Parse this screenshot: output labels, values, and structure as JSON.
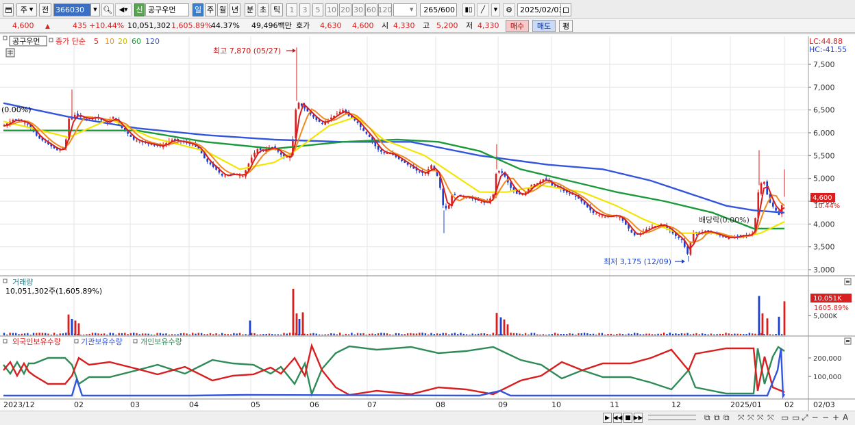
{
  "toolbar": {
    "mode": "주",
    "prev_label": "전",
    "code": "366030",
    "name_tag": "신",
    "name": "공구우먼",
    "periods": [
      "일",
      "주",
      "월",
      "년",
      "분",
      "초",
      "틱"
    ],
    "active_period": "일",
    "intervals": [
      "1",
      "3",
      "5",
      "10",
      "20",
      "30",
      "60",
      "120"
    ],
    "count": "265",
    "count_total": "/600",
    "date": "2025/02/03"
  },
  "quote": {
    "price": "4,600",
    "change": "435",
    "change_pct": "+10.44%",
    "volume": "10,051,302",
    "volume_pct": "1,605.89%",
    "turnover_pct": "44.37%",
    "amount": "49,496백만",
    "bid_label": "호가",
    "bid1": "4,630",
    "bid2": "4,600",
    "open_label": "시",
    "open": "4,330",
    "high_label": "고",
    "high": "5,200",
    "low_label": "저",
    "low": "4,330",
    "buy_label": "매수",
    "sell_label": "매도",
    "eval_label": "평"
  },
  "price_panel": {
    "stock_label": "공구우먼",
    "indicator_label": "종가 단순",
    "ma_labels": [
      "5",
      "10",
      "20",
      "60",
      "120"
    ],
    "ma_colors": [
      "#d81e1e",
      "#f08a1e",
      "#e8d800",
      "#1a9a3a",
      "#3355dd"
    ],
    "lc": "LC:44.88",
    "hc": "HC:-41.55",
    "high_annot": "최고 7,870 (05/27)",
    "low_annot": "최저 3,175 (12/09)",
    "start_pct": "(0.00%)",
    "dividend": "배당락(0.00%)",
    "last_price": "4,600",
    "last_pct": "10.44%",
    "y_ticks": [
      "7,500",
      "7,000",
      "6,500",
      "6,000",
      "5,500",
      "5,000",
      "4,500",
      "4,000",
      "3,500",
      "3,000"
    ]
  },
  "volume_panel": {
    "title": "거래량",
    "subtitle": "10,051,302주(1,605.89%)",
    "last_value": "10,051K",
    "last_pct": "1605.89%",
    "tick": "5,000K"
  },
  "holding_panel": {
    "legend": [
      "외국인보유수량",
      "기관보유수량",
      "개인보유수량"
    ],
    "colors": [
      "#d81e1e",
      "#3355dd",
      "#2e8b57"
    ],
    "ticks": [
      "200,000",
      "100,000"
    ]
  },
  "x_axis": {
    "labels": [
      "2023/12",
      "02",
      "03",
      "04",
      "05",
      "06",
      "07",
      "08",
      "09",
      "10",
      "11",
      "12",
      "2025/01",
      "02",
      "02/03"
    ]
  },
  "chart_data": {
    "type": "candlestick",
    "ylim": [
      2900,
      7900
    ],
    "annotations": [
      {
        "text": "최고 7,870 (05/27)",
        "value": 7870
      },
      {
        "text": "최저 3,175 (12/09)",
        "value": 3175
      }
    ],
    "close_path": [
      [
        0,
        6100
      ],
      [
        10,
        6200
      ],
      [
        20,
        6300
      ],
      [
        30,
        6250
      ],
      [
        40,
        6200
      ],
      [
        55,
        5900
      ],
      [
        70,
        5750
      ],
      [
        85,
        5600
      ],
      [
        95,
        5700
      ],
      [
        100,
        6300
      ],
      [
        110,
        6400
      ],
      [
        125,
        6300
      ],
      [
        140,
        6350
      ],
      [
        155,
        6200
      ],
      [
        165,
        6350
      ],
      [
        175,
        6150
      ],
      [
        185,
        6000
      ],
      [
        195,
        5850
      ],
      [
        205,
        5800
      ],
      [
        220,
        5750
      ],
      [
        235,
        5700
      ],
      [
        250,
        5850
      ],
      [
        265,
        5800
      ],
      [
        280,
        5750
      ],
      [
        290,
        5650
      ],
      [
        300,
        5400
      ],
      [
        315,
        5200
      ],
      [
        325,
        5050
      ],
      [
        340,
        5100
      ],
      [
        355,
        5050
      ],
      [
        365,
        5400
      ],
      [
        375,
        5650
      ],
      [
        385,
        5600
      ],
      [
        395,
        5700
      ],
      [
        405,
        5600
      ],
      [
        415,
        5450
      ],
      [
        425,
        5500
      ],
      [
        433,
        6700
      ],
      [
        440,
        6600
      ],
      [
        450,
        6450
      ],
      [
        460,
        6300
      ],
      [
        470,
        6200
      ],
      [
        480,
        6300
      ],
      [
        490,
        6400
      ],
      [
        500,
        6500
      ],
      [
        510,
        6350
      ],
      [
        520,
        6250
      ],
      [
        530,
        6050
      ],
      [
        540,
        5900
      ],
      [
        550,
        5650
      ],
      [
        560,
        5550
      ],
      [
        570,
        5550
      ],
      [
        580,
        5450
      ],
      [
        590,
        5350
      ],
      [
        600,
        5250
      ],
      [
        610,
        5150
      ],
      [
        620,
        5100
      ],
      [
        630,
        5300
      ],
      [
        640,
        5000
      ],
      [
        648,
        4300
      ],
      [
        655,
        4400
      ],
      [
        660,
        4650
      ],
      [
        670,
        4600
      ],
      [
        680,
        4600
      ],
      [
        690,
        4550
      ],
      [
        700,
        4500
      ],
      [
        710,
        4450
      ],
      [
        720,
        4650
      ],
      [
        725,
        5200
      ],
      [
        735,
        5100
      ],
      [
        745,
        4800
      ],
      [
        755,
        4650
      ],
      [
        765,
        4650
      ],
      [
        775,
        4850
      ],
      [
        785,
        4900
      ],
      [
        795,
        5000
      ],
      [
        805,
        4850
      ],
      [
        815,
        4800
      ],
      [
        825,
        4700
      ],
      [
        835,
        4650
      ],
      [
        845,
        4550
      ],
      [
        855,
        4400
      ],
      [
        865,
        4250
      ],
      [
        875,
        4200
      ],
      [
        885,
        4150
      ],
      [
        895,
        4200
      ],
      [
        905,
        4150
      ],
      [
        915,
        3950
      ],
      [
        925,
        3750
      ],
      [
        935,
        3800
      ],
      [
        945,
        3900
      ],
      [
        955,
        3950
      ],
      [
        965,
        4000
      ],
      [
        975,
        3900
      ],
      [
        985,
        3750
      ],
      [
        995,
        3650
      ],
      [
        1005,
        3300
      ],
      [
        1010,
        3800
      ],
      [
        1020,
        3800
      ],
      [
        1030,
        3850
      ],
      [
        1040,
        3800
      ],
      [
        1050,
        3750
      ],
      [
        1060,
        3700
      ],
      [
        1070,
        3700
      ],
      [
        1080,
        3750
      ],
      [
        1090,
        3750
      ],
      [
        1100,
        3800
      ],
      [
        1108,
        4850
      ],
      [
        1115,
        4950
      ],
      [
        1122,
        4500
      ],
      [
        1130,
        4350
      ],
      [
        1137,
        4200
      ],
      [
        1145,
        4600
      ]
    ],
    "ma120_path": [
      [
        5,
        6650
      ],
      [
        100,
        6350
      ],
      [
        200,
        6100
      ],
      [
        300,
        5950
      ],
      [
        400,
        5850
      ],
      [
        500,
        5800
      ],
      [
        600,
        5800
      ],
      [
        700,
        5500
      ],
      [
        800,
        5300
      ],
      [
        880,
        5200
      ],
      [
        950,
        4950
      ],
      [
        1000,
        4700
      ],
      [
        1060,
        4400
      ],
      [
        1100,
        4300
      ],
      [
        1145,
        4250
      ]
    ],
    "ma60_path": [
      [
        5,
        6050
      ],
      [
        100,
        6050
      ],
      [
        200,
        6050
      ],
      [
        300,
        5800
      ],
      [
        400,
        5650
      ],
      [
        500,
        5800
      ],
      [
        580,
        5850
      ],
      [
        640,
        5800
      ],
      [
        700,
        5600
      ],
      [
        760,
        5200
      ],
      [
        830,
        4950
      ],
      [
        900,
        4700
      ],
      [
        970,
        4500
      ],
      [
        1040,
        4250
      ],
      [
        1100,
        3900
      ],
      [
        1145,
        3900
      ]
    ],
    "ma20_path": [
      [
        5,
        6250
      ],
      [
        60,
        6050
      ],
      [
        100,
        5900
      ],
      [
        160,
        6300
      ],
      [
        220,
        5900
      ],
      [
        300,
        5600
      ],
      [
        350,
        5200
      ],
      [
        400,
        5350
      ],
      [
        430,
        5600
      ],
      [
        480,
        6150
      ],
      [
        520,
        6350
      ],
      [
        560,
        5850
      ],
      [
        620,
        5500
      ],
      [
        650,
        5200
      ],
      [
        700,
        4700
      ],
      [
        740,
        4700
      ],
      [
        790,
        4850
      ],
      [
        850,
        4700
      ],
      [
        900,
        4400
      ],
      [
        940,
        4100
      ],
      [
        990,
        3800
      ],
      [
        1040,
        3800
      ],
      [
        1080,
        3700
      ],
      [
        1110,
        3800
      ],
      [
        1145,
        4050
      ]
    ],
    "volume_spikes": [
      [
        100,
        0.38
      ],
      [
        105,
        0.3
      ],
      [
        110,
        0.27
      ],
      [
        115,
        0.22
      ],
      [
        365,
        0.27
      ],
      [
        428,
        0.85
      ],
      [
        433,
        0.4
      ],
      [
        437,
        0.3
      ],
      [
        442,
        0.42
      ],
      [
        725,
        0.41
      ],
      [
        731,
        0.33
      ],
      [
        736,
        0.29
      ],
      [
        741,
        0.2
      ],
      [
        1108,
        0.72
      ],
      [
        1113,
        0.4
      ],
      [
        1120,
        0.31
      ],
      [
        1137,
        0.34
      ],
      [
        1145,
        0.62
      ]
    ],
    "foreign_path": [
      [
        5,
        540
      ],
      [
        15,
        528
      ],
      [
        25,
        548
      ],
      [
        35,
        530
      ],
      [
        42,
        542
      ],
      [
        50,
        548
      ],
      [
        70,
        560
      ],
      [
        95,
        560
      ],
      [
        105,
        548
      ],
      [
        115,
        522
      ],
      [
        130,
        532
      ],
      [
        160,
        528
      ],
      [
        200,
        538
      ],
      [
        230,
        546
      ],
      [
        270,
        535
      ],
      [
        310,
        555
      ],
      [
        340,
        548
      ],
      [
        370,
        546
      ],
      [
        395,
        536
      ],
      [
        410,
        545
      ],
      [
        430,
        522
      ],
      [
        445,
        548
      ],
      [
        455,
        504
      ],
      [
        470,
        540
      ],
      [
        490,
        565
      ],
      [
        510,
        576
      ],
      [
        550,
        570
      ],
      [
        600,
        575
      ],
      [
        640,
        565
      ],
      [
        680,
        568
      ],
      [
        720,
        575
      ],
      [
        760,
        555
      ],
      [
        790,
        548
      ],
      [
        820,
        528
      ],
      [
        850,
        540
      ],
      [
        880,
        530
      ],
      [
        920,
        530
      ],
      [
        950,
        522
      ],
      [
        980,
        510
      ],
      [
        1005,
        540
      ],
      [
        1015,
        516
      ],
      [
        1060,
        508
      ],
      [
        1100,
        508
      ],
      [
        1106,
        570
      ],
      [
        1116,
        520
      ],
      [
        1128,
        565
      ],
      [
        1145,
        572
      ]
    ],
    "institution_path": [
      [
        5,
        577
      ],
      [
        105,
        577
      ],
      [
        112,
        553
      ],
      [
        120,
        577
      ],
      [
        280,
        577
      ],
      [
        360,
        576
      ],
      [
        700,
        577
      ],
      [
        730,
        570
      ],
      [
        745,
        577
      ],
      [
        1120,
        577
      ],
      [
        1135,
        540
      ],
      [
        1140,
        508
      ],
      [
        1143,
        578
      ],
      [
        1145,
        575
      ]
    ],
    "individual_path": [
      [
        5,
        532
      ],
      [
        15,
        545
      ],
      [
        25,
        528
      ],
      [
        35,
        545
      ],
      [
        42,
        530
      ],
      [
        50,
        530
      ],
      [
        70,
        522
      ],
      [
        95,
        522
      ],
      [
        105,
        532
      ],
      [
        115,
        560
      ],
      [
        130,
        550
      ],
      [
        160,
        550
      ],
      [
        200,
        540
      ],
      [
        230,
        532
      ],
      [
        270,
        545
      ],
      [
        310,
        525
      ],
      [
        340,
        530
      ],
      [
        370,
        532
      ],
      [
        395,
        545
      ],
      [
        410,
        535
      ],
      [
        430,
        560
      ],
      [
        445,
        530
      ],
      [
        455,
        575
      ],
      [
        470,
        538
      ],
      [
        490,
        515
      ],
      [
        510,
        505
      ],
      [
        550,
        510
      ],
      [
        600,
        506
      ],
      [
        640,
        515
      ],
      [
        680,
        512
      ],
      [
        720,
        506
      ],
      [
        760,
        525
      ],
      [
        790,
        532
      ],
      [
        820,
        552
      ],
      [
        850,
        540
      ],
      [
        880,
        550
      ],
      [
        920,
        550
      ],
      [
        950,
        558
      ],
      [
        980,
        568
      ],
      [
        1005,
        540
      ],
      [
        1015,
        565
      ],
      [
        1060,
        574
      ],
      [
        1100,
        574
      ],
      [
        1106,
        508
      ],
      [
        1116,
        560
      ],
      [
        1128,
        520
      ],
      [
        1136,
        506
      ],
      [
        1145,
        512
      ]
    ]
  }
}
